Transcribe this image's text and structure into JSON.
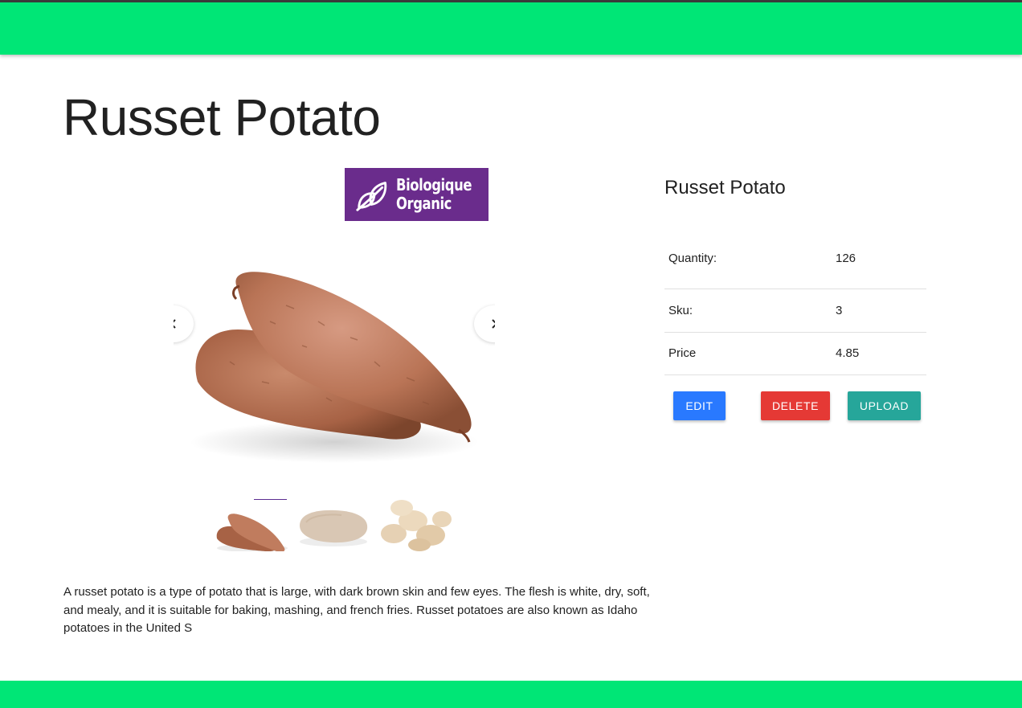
{
  "header": {},
  "product": {
    "title": "Russet Potato",
    "description": "A russet potato is a type of potato that is large, with dark brown skin and few eyes. The flesh is white, dry, soft, and mealy, and it is suitable for baking, mashing, and french fries. Russet potatoes are also known as Idaho potatoes in the United S"
  },
  "badge": {
    "line1": "Biologique",
    "line2": "Organic",
    "color": "#6a2c8c"
  },
  "carousel": {
    "prev_icon": "chevron-left-icon",
    "next_icon": "chevron-right-icon",
    "thumbnails": [
      "sweet-potato-thumb",
      "russet-potato-thumb",
      "baby-potatoes-thumb"
    ],
    "active_index": 0
  },
  "details": {
    "title": "Russet Potato",
    "rows": [
      {
        "label": "Quantity:",
        "value": "126"
      },
      {
        "label": "Sku:",
        "value": "3"
      },
      {
        "label": "Price",
        "value": "4.85"
      }
    ]
  },
  "actions": {
    "edit": "Edit",
    "delete": "Delete",
    "upload": "Upload"
  },
  "colors": {
    "bar": "#00e676",
    "edit": "#2979ff",
    "delete": "#e53935",
    "upload": "#26a69a"
  }
}
